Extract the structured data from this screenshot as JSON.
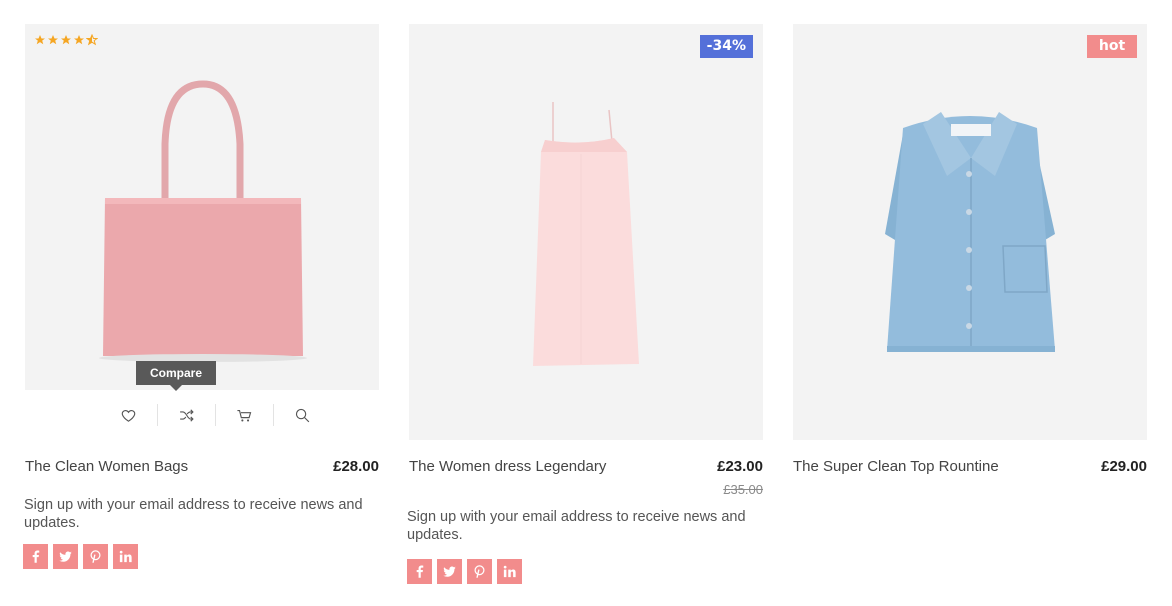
{
  "colors": {
    "accent": "#f28c8c",
    "sale_badge": "#5470d9",
    "star": "#f5a623",
    "image_bg": "#f3f3f3"
  },
  "products": [
    {
      "name": "The Clean Women Bags",
      "price": "£28.00",
      "rating": 4.5,
      "tooltip": "Compare",
      "description": "Sign up with your email address to receive news and updates.",
      "actions": [
        "heart-icon",
        "shuffle-icon",
        "cart-icon",
        "search-icon"
      ],
      "socials": [
        "facebook-icon",
        "twitter-icon",
        "pinterest-icon",
        "linkedin-icon"
      ]
    },
    {
      "name": "The Women dress Legendary",
      "price": "£23.00",
      "old_price": "£35.00",
      "badge": "-34%",
      "description": "Sign up with your email address to receive news and updates.",
      "socials": [
        "facebook-icon",
        "twitter-icon",
        "pinterest-icon",
        "linkedin-icon"
      ]
    },
    {
      "name": "The Super Clean Top Rountine",
      "price": "£29.00",
      "badge": "hot"
    }
  ]
}
